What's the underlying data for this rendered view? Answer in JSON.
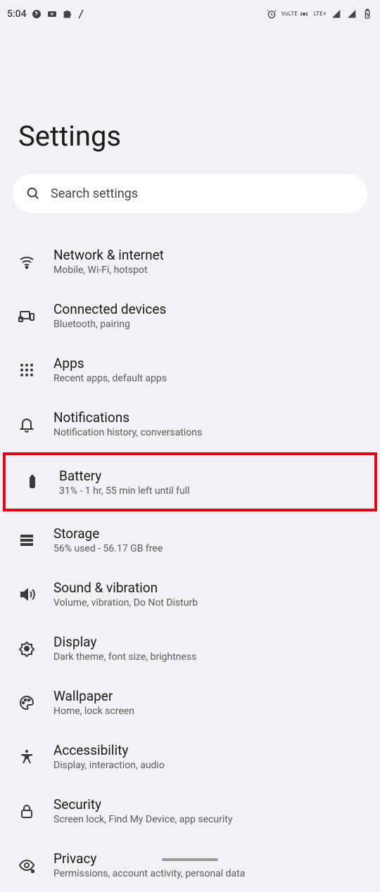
{
  "status_bar": {
    "time": "5:04",
    "lte_label": "LTE+",
    "volte_label": "VoLTE"
  },
  "page": {
    "title": "Settings"
  },
  "search": {
    "placeholder": "Search settings"
  },
  "items": {
    "network": {
      "title": "Network & internet",
      "sub": "Mobile, Wi-Fi, hotspot"
    },
    "devices": {
      "title": "Connected devices",
      "sub": "Bluetooth, pairing"
    },
    "apps": {
      "title": "Apps",
      "sub": "Recent apps, default apps"
    },
    "notifs": {
      "title": "Notifications",
      "sub": "Notification history, conversations"
    },
    "battery": {
      "title": "Battery",
      "sub": "31% - 1 hr, 55 min left until full"
    },
    "storage": {
      "title": "Storage",
      "sub": "56% used - 56.17 GB free"
    },
    "sound": {
      "title": "Sound & vibration",
      "sub": "Volume, vibration, Do Not Disturb"
    },
    "display": {
      "title": "Display",
      "sub": "Dark theme, font size, brightness"
    },
    "wallpaper": {
      "title": "Wallpaper",
      "sub": "Home, lock screen"
    },
    "a11y": {
      "title": "Accessibility",
      "sub": "Display, interaction, audio"
    },
    "security": {
      "title": "Security",
      "sub": "Screen lock, Find My Device, app security"
    },
    "privacy": {
      "title": "Privacy",
      "sub": "Permissions, account activity, personal data"
    }
  }
}
